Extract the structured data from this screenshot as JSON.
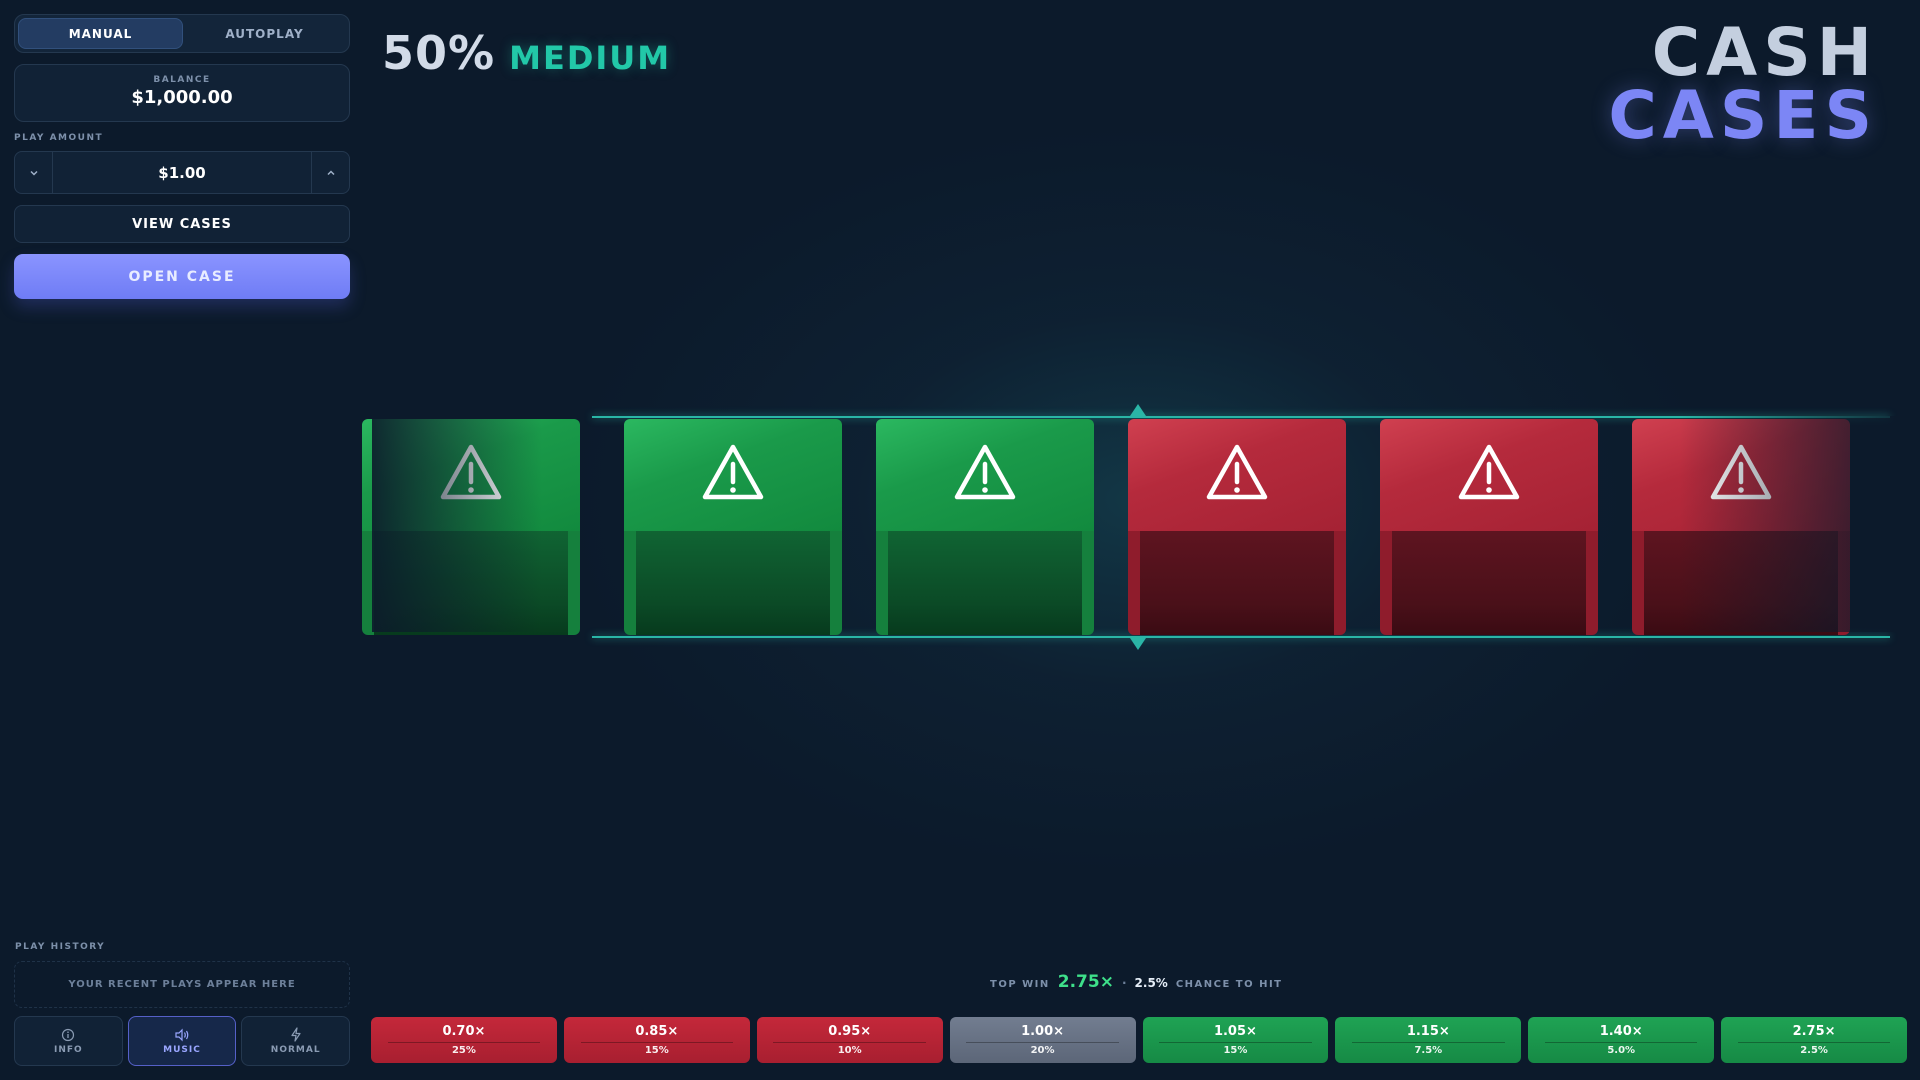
{
  "sidebar": {
    "modes": [
      {
        "label": "MANUAL",
        "active": true
      },
      {
        "label": "AUTOPLAY",
        "active": false
      }
    ],
    "balance": {
      "label": "BALANCE",
      "value": "$1,000.00"
    },
    "play_amount": {
      "label": "PLAY AMOUNT",
      "value": "$1.00"
    },
    "view_cases_label": "VIEW CASES",
    "open_case_label": "OPEN CASE",
    "history": {
      "label": "PLAY HISTORY",
      "empty_text": "YOUR RECENT PLAYS APPEAR HERE"
    },
    "bottom_buttons": [
      {
        "label": "INFO",
        "icon": "info-icon",
        "active": false
      },
      {
        "label": "MUSIC",
        "icon": "speaker-icon",
        "active": true
      },
      {
        "label": "NORMAL",
        "icon": "lightning-icon",
        "active": false
      }
    ]
  },
  "header": {
    "risk_percent": "50%",
    "risk_level": "MEDIUM"
  },
  "logo": {
    "line1": "CASH",
    "line2": "CASES"
  },
  "reel": {
    "cases": [
      {
        "color": "green",
        "icon": "warning-icon"
      },
      {
        "color": "green",
        "icon": "warning-icon"
      },
      {
        "color": "green",
        "icon": "warning-icon"
      },
      {
        "color": "red",
        "icon": "warning-icon"
      },
      {
        "color": "red",
        "icon": "warning-icon"
      },
      {
        "color": "red",
        "icon": "warning-icon"
      }
    ]
  },
  "top_win": {
    "label": "TOP WIN",
    "multiplier": "2.75×",
    "separator": "·",
    "chance": "2.5%",
    "chance_label": "CHANCE TO HIT"
  },
  "payouts": [
    {
      "multiplier": "0.70×",
      "chance": "25%",
      "color": "red"
    },
    {
      "multiplier": "0.85×",
      "chance": "15%",
      "color": "red"
    },
    {
      "multiplier": "0.95×",
      "chance": "10%",
      "color": "red"
    },
    {
      "multiplier": "1.00×",
      "chance": "20%",
      "color": "gray"
    },
    {
      "multiplier": "1.05×",
      "chance": "15%",
      "color": "green"
    },
    {
      "multiplier": "1.15×",
      "chance": "7.5%",
      "color": "green"
    },
    {
      "multiplier": "1.40×",
      "chance": "5.0%",
      "color": "green"
    },
    {
      "multiplier": "2.75×",
      "chance": "2.5%",
      "color": "green"
    }
  ],
  "colors": {
    "accent": "#7c86f5",
    "teal": "#22c8a8",
    "win_green": "#3ee08a",
    "background": "#0c1a2b"
  }
}
